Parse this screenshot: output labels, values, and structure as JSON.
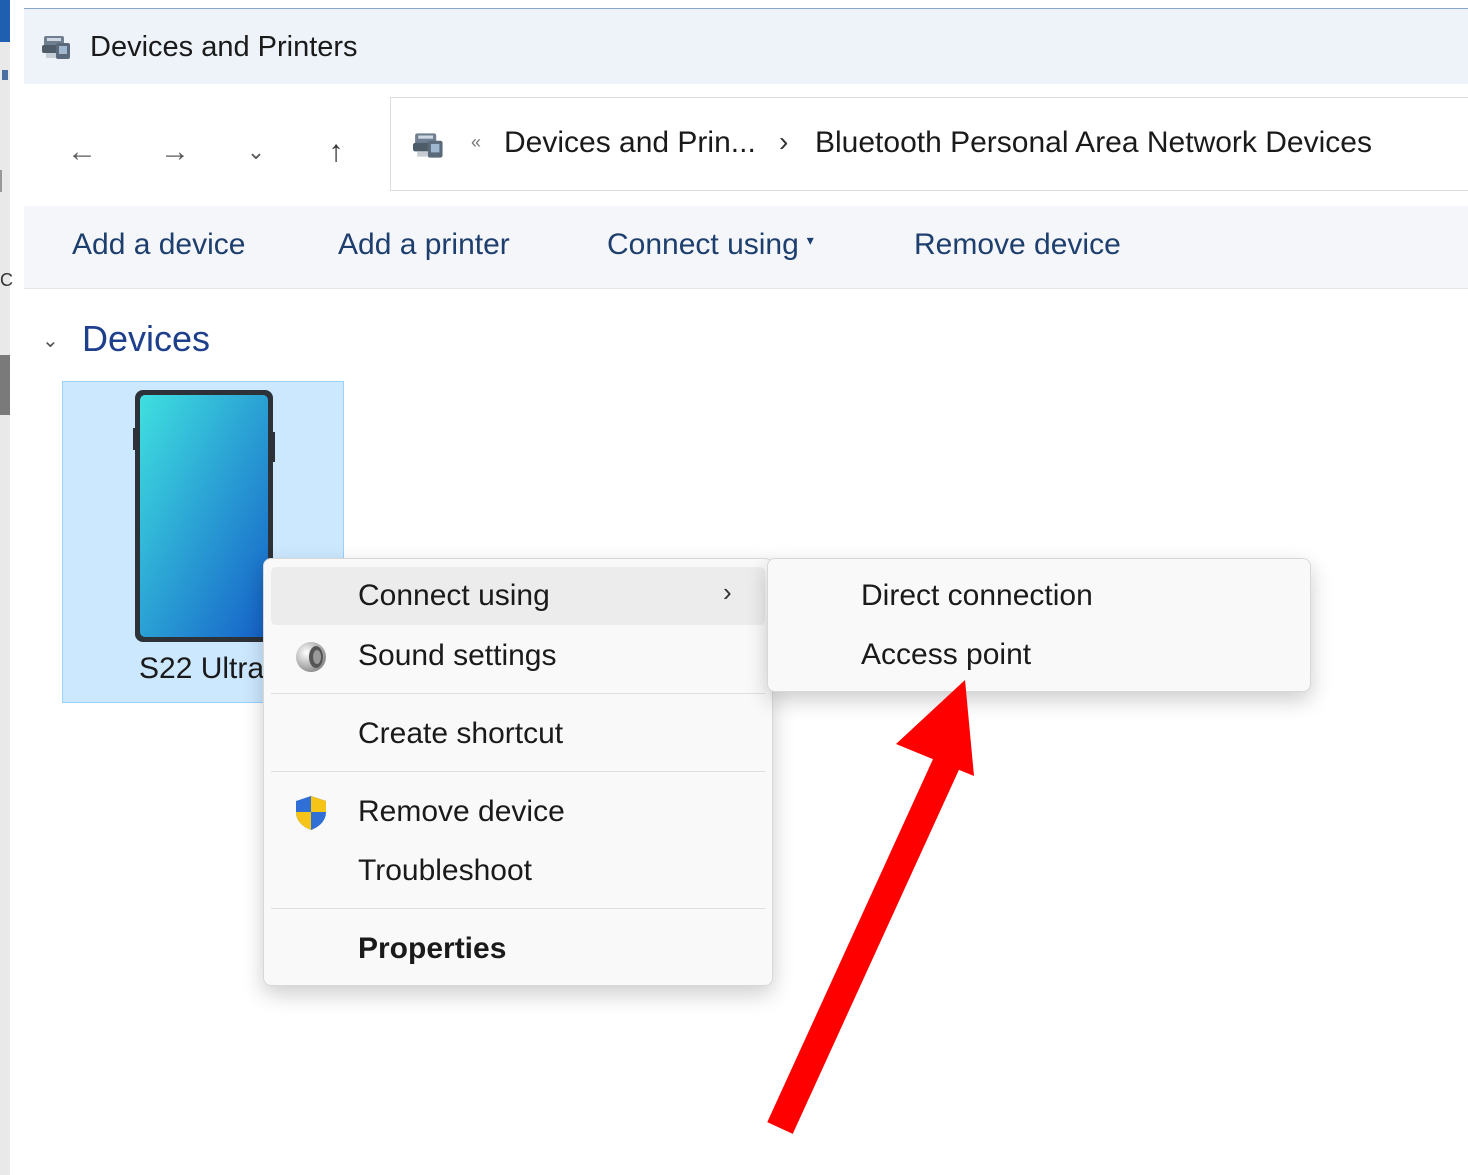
{
  "window": {
    "title": "Devices and Printers"
  },
  "navigation": {
    "back_glyph": "←",
    "forward_glyph": "→",
    "recent_glyph": "⌄",
    "up_glyph": "↑",
    "overflow_glyph": "«",
    "breadcrumbs": [
      "Devices and Prin...",
      "Bluetooth Personal Area Network Devices"
    ],
    "breadcrumb_separator": "›"
  },
  "commands": {
    "add_device": "Add a device",
    "add_printer": "Add a printer",
    "connect_using": "Connect using",
    "remove_device": "Remove device"
  },
  "content": {
    "group_title": "Devices",
    "device_label": "S22 Ultra"
  },
  "context_menu": {
    "items": [
      {
        "label": "Connect using",
        "has_submenu": true,
        "icon": ""
      },
      {
        "label": "Sound settings",
        "icon": "speaker-icon"
      },
      {
        "label": "Create shortcut",
        "icon": ""
      },
      {
        "label": "Remove device",
        "icon": "uac-shield-icon"
      },
      {
        "label": "Troubleshoot",
        "icon": ""
      },
      {
        "label": "Properties",
        "bold": true,
        "icon": ""
      }
    ]
  },
  "submenu": {
    "items": [
      "Direct connection",
      "Access point"
    ]
  },
  "colors": {
    "accent": "#1e3f8c",
    "selection": "#cce8ff",
    "annotation_arrow": "#ff0000"
  }
}
